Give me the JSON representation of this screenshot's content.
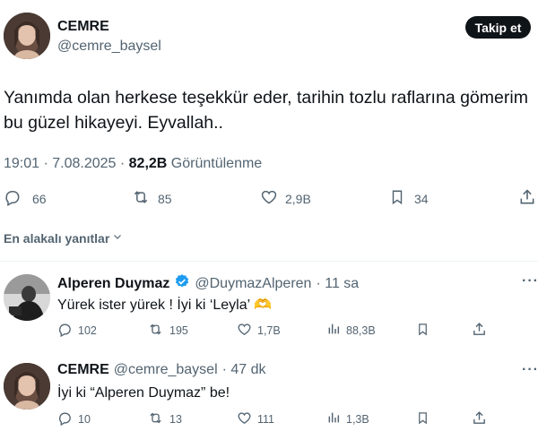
{
  "main_tweet": {
    "display_name": "CEMRE",
    "handle": "@cemre_baysel",
    "follow_label": "Takip et",
    "text": "Yanımda olan herkese teşekkür eder, tarihin tozlu raflarına gömerim bu güzel hikayeyi. Eyvallah..",
    "time": "19:01 · 7.08.2025 · ",
    "views_count": "82,2B",
    "views_label": " Görüntülenme",
    "replies": "66",
    "retweets": "85",
    "likes": "2,9B",
    "bookmarks": "34"
  },
  "sort": {
    "label": "En alakalı yanıtlar"
  },
  "replies": [
    {
      "display_name": "Alperen Duymaz",
      "verified": true,
      "handle": "@DuymazAlperen",
      "time": "· 11 sa",
      "text": "Yürek ister yürek ! İyi ki ‘Leyla’ 🫶",
      "replies": "102",
      "retweets": "195",
      "likes": "1,7B",
      "views": "88,3B"
    },
    {
      "display_name": "CEMRE",
      "verified": false,
      "handle": "@cemre_baysel",
      "time": "· 47 dk",
      "text": "İyi ki “Alperen Duymaz” be!",
      "replies": "10",
      "retweets": "13",
      "likes": "111",
      "views": "1,3B"
    }
  ],
  "icons": {
    "reply": "reply-icon",
    "retweet": "retweet-icon",
    "like": "heart-icon",
    "bookmark": "bookmark-icon",
    "share": "share-icon",
    "views": "views-icon",
    "more": "more-icon",
    "verified": "verified-badge-icon",
    "chevron": "chevron-down-icon"
  },
  "colors": {
    "text": "#0f1419",
    "muted": "#536471",
    "verified": "#1d9bf0",
    "button": "#0f1419"
  }
}
